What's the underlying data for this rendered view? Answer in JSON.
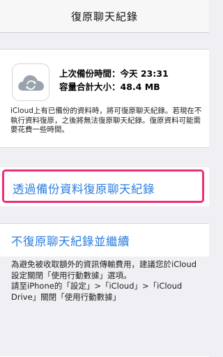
{
  "nav": {
    "title": "復原聊天紀錄"
  },
  "backup": {
    "icon": "icloud-sync-icon",
    "last_backup_label": "上次備份時間：今天 23:31",
    "total_size_label": "容量合計大小：48.4 MB",
    "description": "iCloud上有已備份的資料時，將可復原聊天紀錄。若現在不執行資料復原，之後將無法復原聊天紀錄。復原資料可能需要花費一些時間。"
  },
  "restore": {
    "label": "透過備份資料復原聊天紀錄"
  },
  "skip": {
    "label": "不復原聊天紀錄並繼續",
    "note_1": "為避免被收取額外的資訊傳輸費用，建議您於iCloud設定關閉「使用行動數據」選項。",
    "note_2": "請至iPhone的「設定」>「iCloud」>「iCloud Drive」關閉「使用行動數據」"
  },
  "colors": {
    "link": "#2a7de1",
    "highlight": "#ee2d76",
    "background": "#efeff4"
  }
}
